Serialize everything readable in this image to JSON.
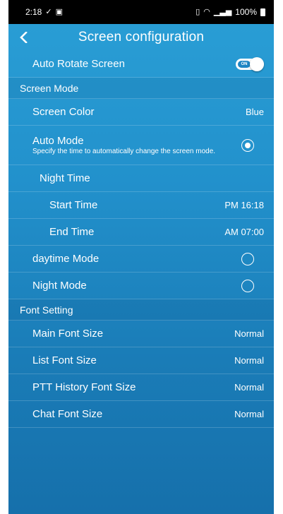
{
  "status_bar": {
    "time": "2:18",
    "battery": "100%",
    "icons": [
      "check-icon",
      "image-icon",
      "vibrate-icon",
      "wifi-icon",
      "signal-icon",
      "battery-icon"
    ]
  },
  "app_bar": {
    "title": "Screen configuration",
    "back_icon": "chevron-left-icon"
  },
  "auto_rotate": {
    "label": "Auto Rotate Screen",
    "toggle_text": "ON",
    "enabled": true
  },
  "screen_mode": {
    "section_label": "Screen Mode",
    "screen_color": {
      "label": "Screen Color",
      "value": "Blue"
    },
    "auto_mode": {
      "label": "Auto Mode",
      "description": "Specify the time to automatically change the screen mode.",
      "selected": true
    },
    "night_time": {
      "label": "Night Time",
      "start": {
        "label": "Start Time",
        "value": "PM 16:18"
      },
      "end": {
        "label": "End Time",
        "value": "AM 07:00"
      }
    },
    "daytime_mode": {
      "label": "daytime Mode",
      "selected": false
    },
    "night_mode": {
      "label": "Night Mode",
      "selected": false
    }
  },
  "font_setting": {
    "section_label": "Font Setting",
    "items": [
      {
        "label": "Main Font Size",
        "value": "Normal"
      },
      {
        "label": "List Font Size",
        "value": "Normal"
      },
      {
        "label": "PTT History Font Size",
        "value": "Normal"
      },
      {
        "label": "Chat Font Size",
        "value": "Normal"
      }
    ]
  },
  "colors": {
    "background_top": "#2a9fd6",
    "background_bottom": "#1670ab",
    "status_bar": "#000000",
    "text": "#ffffff"
  }
}
